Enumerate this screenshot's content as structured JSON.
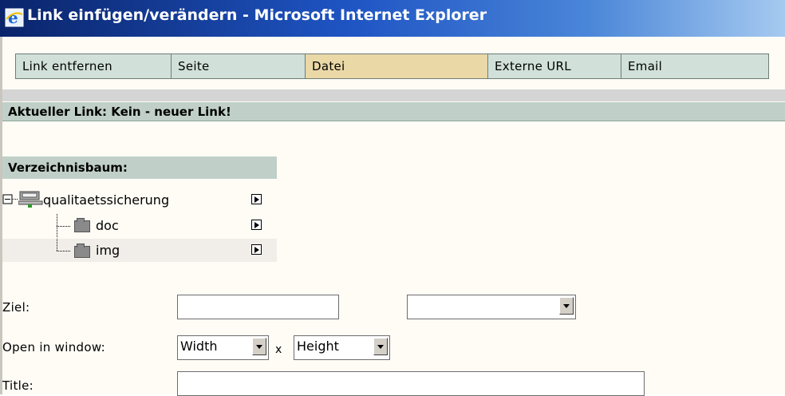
{
  "window": {
    "title": "Link einfügen/verändern - Microsoft Internet Explorer"
  },
  "tabs": [
    {
      "label": "Link entfernen",
      "active": false
    },
    {
      "label": "Seite",
      "active": false
    },
    {
      "label": "Datei",
      "active": true
    },
    {
      "label": "Externe URL",
      "active": false
    },
    {
      "label": "Email",
      "active": false
    }
  ],
  "current_link": "Aktueller Link: Kein - neuer Link!",
  "tree": {
    "heading": "Verzeichnisbaum:",
    "root": "qualitaetssicherung",
    "children": [
      "doc",
      "img"
    ]
  },
  "form": {
    "target_label": "Ziel:",
    "target_value": "",
    "target_select_value": "",
    "open_label": "Open in window:",
    "width_value": "Width",
    "times": "x",
    "height_value": "Height",
    "title_label": "Title:",
    "title_value": ""
  },
  "colors": {
    "active_tab": "#ead8a7",
    "tab": "#d1e1d9",
    "header_bar": "#c0d0c9"
  }
}
